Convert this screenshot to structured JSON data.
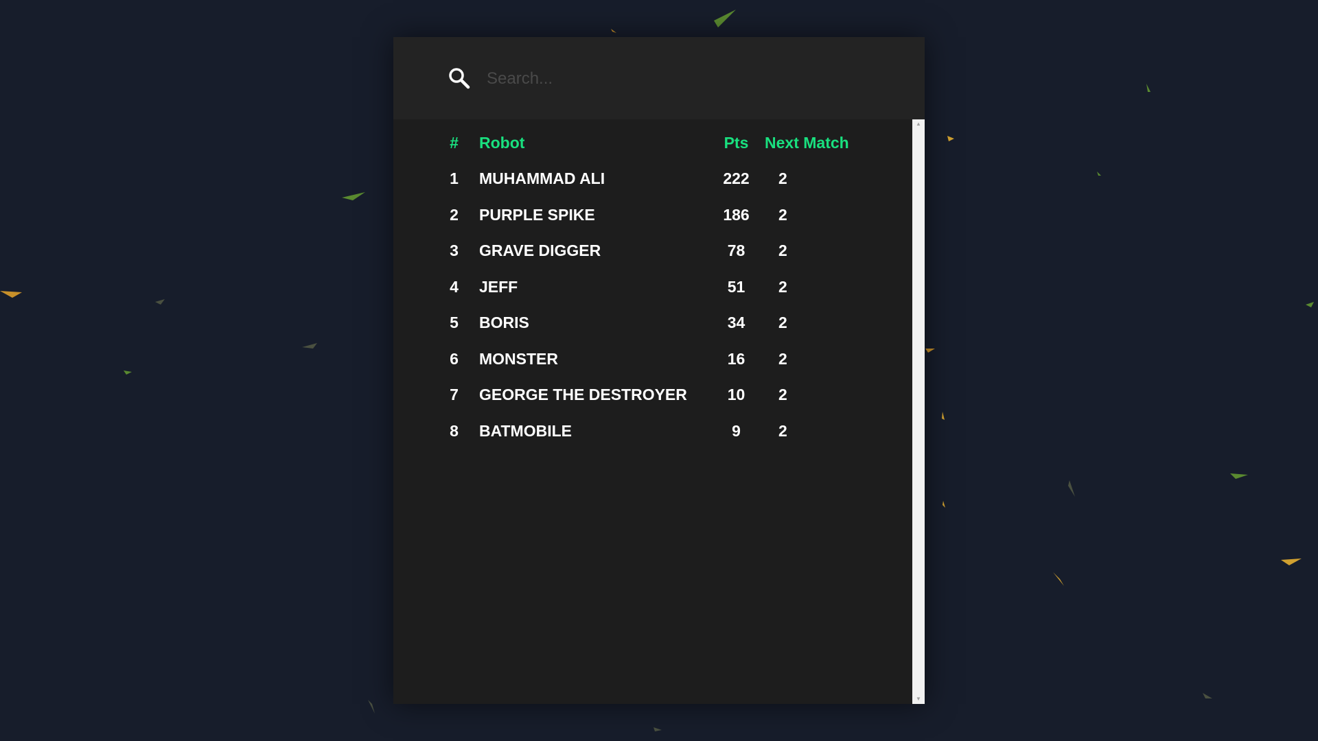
{
  "search": {
    "placeholder": "Search...",
    "value": ""
  },
  "table": {
    "headers": {
      "rank": "#",
      "robot": "Robot",
      "pts": "Pts",
      "next_match": "Next Match"
    },
    "rows": [
      {
        "rank": "1",
        "robot": "MUHAMMAD ALI",
        "pts": "222",
        "next_match": "2"
      },
      {
        "rank": "2",
        "robot": "PURPLE SPIKE",
        "pts": "186",
        "next_match": "2"
      },
      {
        "rank": "3",
        "robot": "GRAVE DIGGER",
        "pts": "78",
        "next_match": "2"
      },
      {
        "rank": "4",
        "robot": "JEFF",
        "pts": "51",
        "next_match": "2"
      },
      {
        "rank": "5",
        "robot": "BORIS",
        "pts": "34",
        "next_match": "2"
      },
      {
        "rank": "6",
        "robot": "MONSTER",
        "pts": "16",
        "next_match": "2"
      },
      {
        "rank": "7",
        "robot": "GEORGE THE DESTROYER",
        "pts": "10",
        "next_match": "2"
      },
      {
        "rank": "8",
        "robot": "BATMOBILE",
        "pts": "9",
        "next_match": "2"
      }
    ]
  },
  "icons": {
    "search": "search-icon",
    "scroll_up": "scroll-up-arrow-icon",
    "scroll_down": "scroll-down-arrow-icon"
  },
  "colors": {
    "background": "#171d2b",
    "panel": "#1d1d1d",
    "search_bar": "#232323",
    "accent": "#19e07f",
    "text": "#ffffff"
  }
}
